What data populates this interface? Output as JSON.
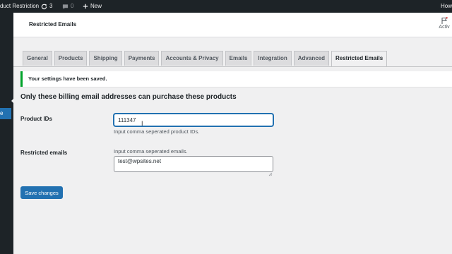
{
  "admin_bar": {
    "site_name": "duct Restriction",
    "updates_count": "3",
    "comments_count": "0",
    "new_label": "New",
    "howdy": "How"
  },
  "header": {
    "title": "Restricted Emails",
    "activity_label": "Activ"
  },
  "tabs": [
    {
      "label": "General"
    },
    {
      "label": "Products"
    },
    {
      "label": "Shipping"
    },
    {
      "label": "Payments"
    },
    {
      "label": "Accounts & Privacy"
    },
    {
      "label": "Emails"
    },
    {
      "label": "Integration"
    },
    {
      "label": "Advanced"
    },
    {
      "label": "Restricted Emails",
      "active": true
    }
  ],
  "notice": {
    "text": "Your settings have been saved."
  },
  "section": {
    "heading": "Only these billing email addresses can purchase these products"
  },
  "fields": {
    "product_ids": {
      "label": "Product IDs",
      "value": "111347",
      "description": "Input comma seperated product IDs."
    },
    "restricted_emails": {
      "label": "Restricted emails",
      "description": "Input comma seperated emails.",
      "value": "test@wpsites.net"
    }
  },
  "save_button": {
    "label": "Save changes"
  },
  "colors": {
    "admin_bar_bg": "#1d2327",
    "primary": "#2271b1",
    "notice_success": "#00a32a",
    "page_bg": "#f0f0f1"
  }
}
